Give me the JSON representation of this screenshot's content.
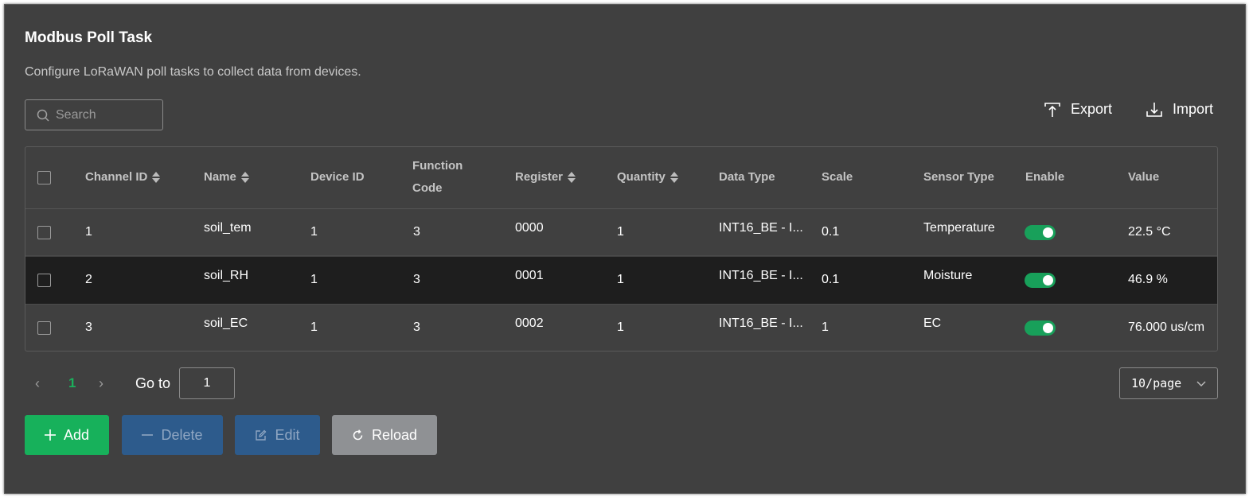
{
  "page": {
    "title": "Modbus Poll Task",
    "subtitle": "Configure LoRaWAN poll tasks to collect data from devices."
  },
  "search": {
    "placeholder": "Search",
    "value": ""
  },
  "toolbar": {
    "export_label": "Export",
    "import_label": "Import"
  },
  "table": {
    "columns": {
      "channel_id": "Channel ID",
      "name": "Name",
      "device_id": "Device ID",
      "function_code_line1": "Function",
      "function_code_line2": "Code",
      "register": "Register",
      "quantity": "Quantity",
      "data_type": "Data Type",
      "scale": "Scale",
      "sensor_type": "Sensor Type",
      "enable": "Enable",
      "value": "Value"
    },
    "rows": [
      {
        "channel_id": "1",
        "name": "soil_tem",
        "device_id": "1",
        "function_code": "3",
        "register": "0000",
        "quantity": "1",
        "data_type": "INT16_BE - I...",
        "scale": "0.1",
        "sensor_type": "Temperature",
        "enable": true,
        "value": "22.5 °C"
      },
      {
        "channel_id": "2",
        "name": "soil_RH",
        "device_id": "1",
        "function_code": "3",
        "register": "0001",
        "quantity": "1",
        "data_type": "INT16_BE - I...",
        "scale": "0.1",
        "sensor_type": "Moisture",
        "enable": true,
        "value": "46.9 %"
      },
      {
        "channel_id": "3",
        "name": "soil_EC",
        "device_id": "1",
        "function_code": "3",
        "register": "0002",
        "quantity": "1",
        "data_type": "INT16_BE - I...",
        "scale": "1",
        "sensor_type": "EC",
        "enable": true,
        "value": "76.000 us/cm"
      }
    ]
  },
  "pagination": {
    "prev": "‹",
    "current_page": "1",
    "next": "›",
    "goto_label": "Go to",
    "goto_value": "1",
    "page_size": "10/page"
  },
  "actions": {
    "add_label": "Add",
    "delete_label": "Delete",
    "edit_label": "Edit",
    "reload_label": "Reload"
  },
  "colors": {
    "background": "#404040",
    "accent_green": "#17b15b",
    "disabled_blue": "#2d5b8c",
    "reload_gray": "#8f9194",
    "selected_row": "#1e1e1e"
  }
}
